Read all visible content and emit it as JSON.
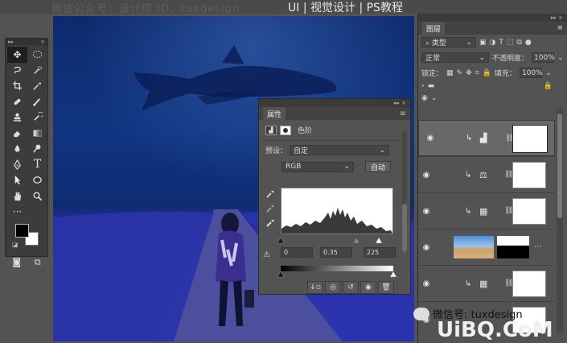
{
  "watermark": {
    "top_left": "微信公众号：设计庶   ID：tuxdesign",
    "top_right": "UI | 视觉设计 | PS教程",
    "bottom_wechat": "微信号: tuxdesign",
    "bottom_site": "UiBQ.CoM"
  },
  "toolbox": {
    "icons": [
      "move-tool-icon",
      "marquee-tool-icon",
      "lasso-tool-icon",
      "quick-select-icon",
      "crop-tool-icon",
      "eyedropper-icon",
      "healing-brush-icon",
      "brush-tool-icon",
      "clone-stamp-icon",
      "history-brush-icon",
      "eraser-icon",
      "gradient-tool-icon",
      "blur-tool-icon",
      "dodge-tool-icon",
      "pen-tool-icon",
      "type-tool-icon",
      "path-select-icon",
      "ellipse-tool-icon",
      "hand-tool-icon",
      "zoom-tool-icon"
    ],
    "more": "···",
    "foreground_color": "#000000",
    "background_color": "#ffffff"
  },
  "properties": {
    "tab": "属性",
    "adjustment": "色阶",
    "preset_label": "预设：",
    "preset_value": "自定",
    "channel": "RGB",
    "auto_button": "自动",
    "input_black": "0",
    "input_gamma": "0.35",
    "input_white": "225"
  },
  "layers": {
    "tab": "图层",
    "filter": "类型",
    "blend_mode": "正常",
    "opacity_label": "不透明度：",
    "opacity": "100%",
    "lock_label": "锁定：",
    "fill_label": "填充：",
    "fill": "100%"
  },
  "colors": {
    "ui_bg": "#535353",
    "panel_dark": "#3b3b3b",
    "canvas_blue": "#1c2d9a"
  }
}
